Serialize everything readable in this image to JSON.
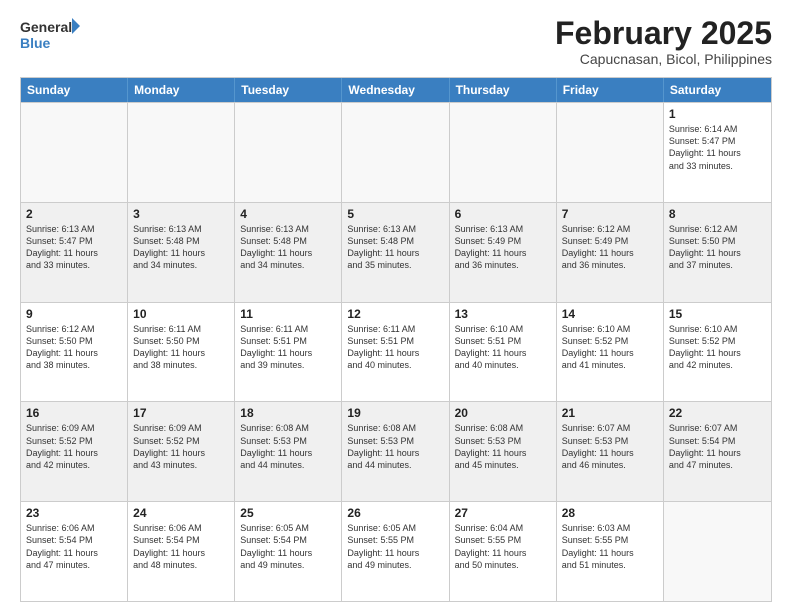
{
  "header": {
    "logo_line1": "General",
    "logo_line2": "Blue",
    "title": "February 2025",
    "subtitle": "Capucnasan, Bicol, Philippines"
  },
  "weekdays": [
    "Sunday",
    "Monday",
    "Tuesday",
    "Wednesday",
    "Thursday",
    "Friday",
    "Saturday"
  ],
  "weeks": [
    [
      {
        "day": "",
        "info": "",
        "empty": true
      },
      {
        "day": "",
        "info": "",
        "empty": true
      },
      {
        "day": "",
        "info": "",
        "empty": true
      },
      {
        "day": "",
        "info": "",
        "empty": true
      },
      {
        "day": "",
        "info": "",
        "empty": true
      },
      {
        "day": "",
        "info": "",
        "empty": true
      },
      {
        "day": "1",
        "info": "Sunrise: 6:14 AM\nSunset: 5:47 PM\nDaylight: 11 hours\nand 33 minutes.",
        "empty": false
      }
    ],
    [
      {
        "day": "2",
        "info": "Sunrise: 6:13 AM\nSunset: 5:47 PM\nDaylight: 11 hours\nand 33 minutes.",
        "empty": false
      },
      {
        "day": "3",
        "info": "Sunrise: 6:13 AM\nSunset: 5:48 PM\nDaylight: 11 hours\nand 34 minutes.",
        "empty": false
      },
      {
        "day": "4",
        "info": "Sunrise: 6:13 AM\nSunset: 5:48 PM\nDaylight: 11 hours\nand 34 minutes.",
        "empty": false
      },
      {
        "day": "5",
        "info": "Sunrise: 6:13 AM\nSunset: 5:48 PM\nDaylight: 11 hours\nand 35 minutes.",
        "empty": false
      },
      {
        "day": "6",
        "info": "Sunrise: 6:13 AM\nSunset: 5:49 PM\nDaylight: 11 hours\nand 36 minutes.",
        "empty": false
      },
      {
        "day": "7",
        "info": "Sunrise: 6:12 AM\nSunset: 5:49 PM\nDaylight: 11 hours\nand 36 minutes.",
        "empty": false
      },
      {
        "day": "8",
        "info": "Sunrise: 6:12 AM\nSunset: 5:50 PM\nDaylight: 11 hours\nand 37 minutes.",
        "empty": false
      }
    ],
    [
      {
        "day": "9",
        "info": "Sunrise: 6:12 AM\nSunset: 5:50 PM\nDaylight: 11 hours\nand 38 minutes.",
        "empty": false
      },
      {
        "day": "10",
        "info": "Sunrise: 6:11 AM\nSunset: 5:50 PM\nDaylight: 11 hours\nand 38 minutes.",
        "empty": false
      },
      {
        "day": "11",
        "info": "Sunrise: 6:11 AM\nSunset: 5:51 PM\nDaylight: 11 hours\nand 39 minutes.",
        "empty": false
      },
      {
        "day": "12",
        "info": "Sunrise: 6:11 AM\nSunset: 5:51 PM\nDaylight: 11 hours\nand 40 minutes.",
        "empty": false
      },
      {
        "day": "13",
        "info": "Sunrise: 6:10 AM\nSunset: 5:51 PM\nDaylight: 11 hours\nand 40 minutes.",
        "empty": false
      },
      {
        "day": "14",
        "info": "Sunrise: 6:10 AM\nSunset: 5:52 PM\nDaylight: 11 hours\nand 41 minutes.",
        "empty": false
      },
      {
        "day": "15",
        "info": "Sunrise: 6:10 AM\nSunset: 5:52 PM\nDaylight: 11 hours\nand 42 minutes.",
        "empty": false
      }
    ],
    [
      {
        "day": "16",
        "info": "Sunrise: 6:09 AM\nSunset: 5:52 PM\nDaylight: 11 hours\nand 42 minutes.",
        "empty": false
      },
      {
        "day": "17",
        "info": "Sunrise: 6:09 AM\nSunset: 5:52 PM\nDaylight: 11 hours\nand 43 minutes.",
        "empty": false
      },
      {
        "day": "18",
        "info": "Sunrise: 6:08 AM\nSunset: 5:53 PM\nDaylight: 11 hours\nand 44 minutes.",
        "empty": false
      },
      {
        "day": "19",
        "info": "Sunrise: 6:08 AM\nSunset: 5:53 PM\nDaylight: 11 hours\nand 44 minutes.",
        "empty": false
      },
      {
        "day": "20",
        "info": "Sunrise: 6:08 AM\nSunset: 5:53 PM\nDaylight: 11 hours\nand 45 minutes.",
        "empty": false
      },
      {
        "day": "21",
        "info": "Sunrise: 6:07 AM\nSunset: 5:53 PM\nDaylight: 11 hours\nand 46 minutes.",
        "empty": false
      },
      {
        "day": "22",
        "info": "Sunrise: 6:07 AM\nSunset: 5:54 PM\nDaylight: 11 hours\nand 47 minutes.",
        "empty": false
      }
    ],
    [
      {
        "day": "23",
        "info": "Sunrise: 6:06 AM\nSunset: 5:54 PM\nDaylight: 11 hours\nand 47 minutes.",
        "empty": false
      },
      {
        "day": "24",
        "info": "Sunrise: 6:06 AM\nSunset: 5:54 PM\nDaylight: 11 hours\nand 48 minutes.",
        "empty": false
      },
      {
        "day": "25",
        "info": "Sunrise: 6:05 AM\nSunset: 5:54 PM\nDaylight: 11 hours\nand 49 minutes.",
        "empty": false
      },
      {
        "day": "26",
        "info": "Sunrise: 6:05 AM\nSunset: 5:55 PM\nDaylight: 11 hours\nand 49 minutes.",
        "empty": false
      },
      {
        "day": "27",
        "info": "Sunrise: 6:04 AM\nSunset: 5:55 PM\nDaylight: 11 hours\nand 50 minutes.",
        "empty": false
      },
      {
        "day": "28",
        "info": "Sunrise: 6:03 AM\nSunset: 5:55 PM\nDaylight: 11 hours\nand 51 minutes.",
        "empty": false
      },
      {
        "day": "",
        "info": "",
        "empty": true
      }
    ]
  ]
}
